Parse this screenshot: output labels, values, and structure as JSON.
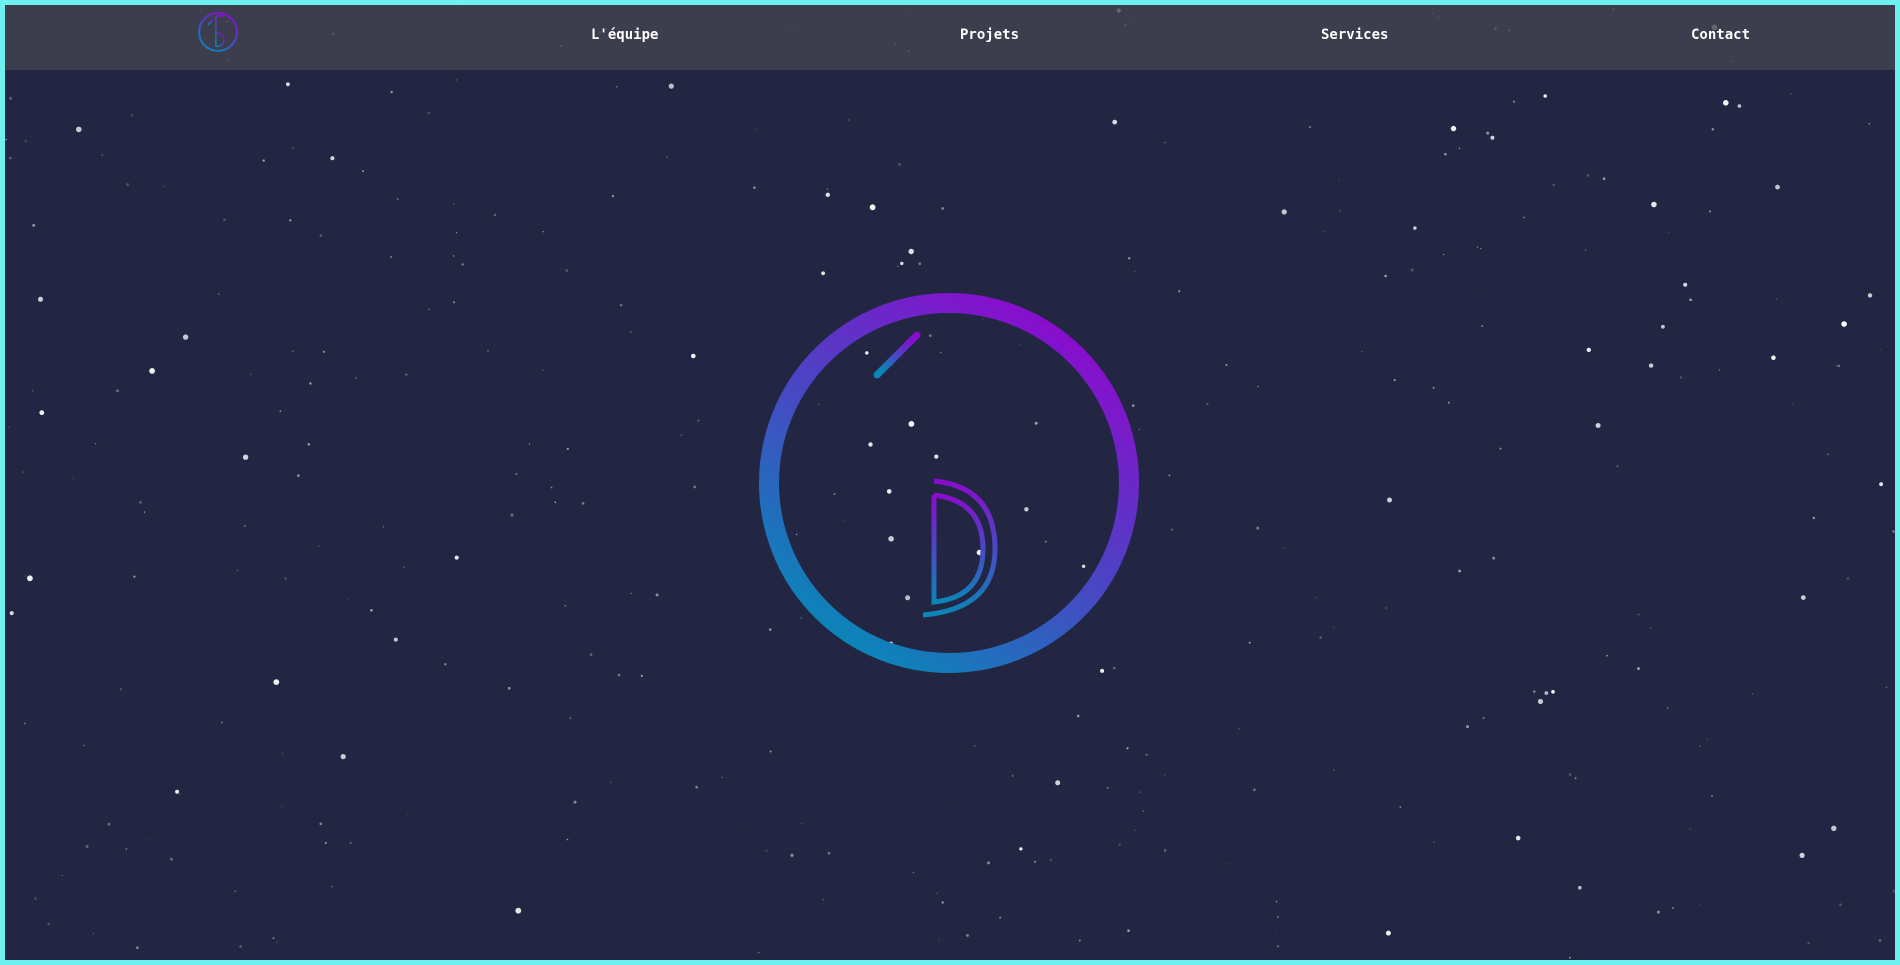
{
  "nav": {
    "logo_icon": "circled-15-logo-icon",
    "links": [
      {
        "label": "L'équipe"
      },
      {
        "label": "Projets"
      },
      {
        "label": "Services"
      },
      {
        "label": "Contact"
      }
    ]
  },
  "hero": {
    "logo_icon": "circled-15-logo-icon"
  },
  "colors": {
    "background": "#222643",
    "border": "#6ef0f0",
    "navbar": "#3a3a48",
    "nav_text": "#ffffff",
    "gradient_start": "#0a86b8",
    "gradient_end": "#8a0ccd",
    "stars": "#ffffff"
  }
}
